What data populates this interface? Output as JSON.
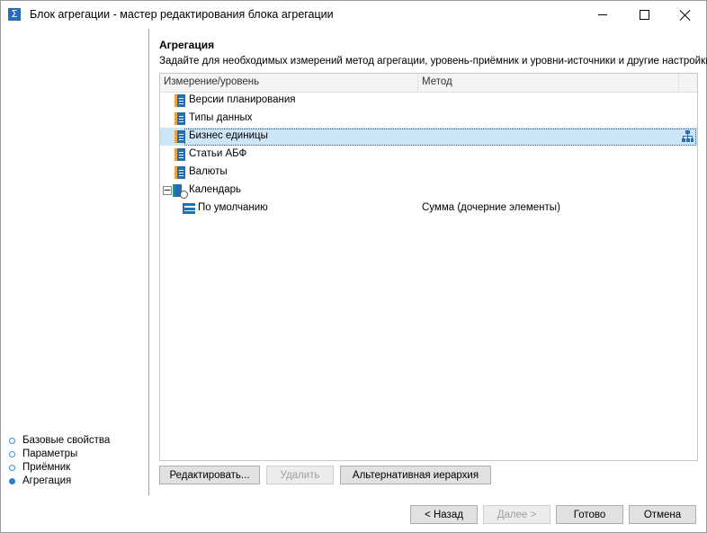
{
  "window": {
    "title": "Блок агрегации - мастер редактирования блока агрегации",
    "icon": "sigma-icon"
  },
  "steps": [
    {
      "label": "Базовые свойства",
      "active": false
    },
    {
      "label": "Параметры",
      "active": false
    },
    {
      "label": "Приёмник",
      "active": false
    },
    {
      "label": "Агрегация",
      "active": true
    }
  ],
  "page": {
    "title": "Агрегация",
    "description": "Задайте для необходимых измерений метод агрегации, уровень-приёмник и уровни-источники и другие настройки."
  },
  "grid": {
    "columns": [
      "Измерение/уровень",
      "Метод"
    ],
    "rows": [
      {
        "label": "Версии планирования",
        "method": "",
        "type": "dimension"
      },
      {
        "label": "Типы данных",
        "method": "",
        "type": "dimension"
      },
      {
        "label": "Бизнес единицы",
        "method": "",
        "type": "dimension",
        "selected": true
      },
      {
        "label": "Статьи АБФ",
        "method": "",
        "type": "dimension"
      },
      {
        "label": "Валюты",
        "method": "",
        "type": "dimension"
      },
      {
        "label": "Календарь",
        "method": "",
        "type": "calendar",
        "expanded": true
      },
      {
        "label": "По умолчанию",
        "method": "Сумма (дочерние элементы)",
        "type": "level"
      }
    ]
  },
  "actions": {
    "edit": "Редактировать...",
    "delete": "Удалить",
    "alt_hierarchy": "Альтернативная иерархия"
  },
  "footer": {
    "back": "< Назад",
    "next": "Далее >",
    "finish": "Готово",
    "cancel": "Отмена"
  },
  "colors": {
    "selection": "#cde6f7",
    "accent": "#2a7fc8",
    "dimension_blue": "#1f6fb5",
    "dimension_orange": "#f0a23a"
  }
}
